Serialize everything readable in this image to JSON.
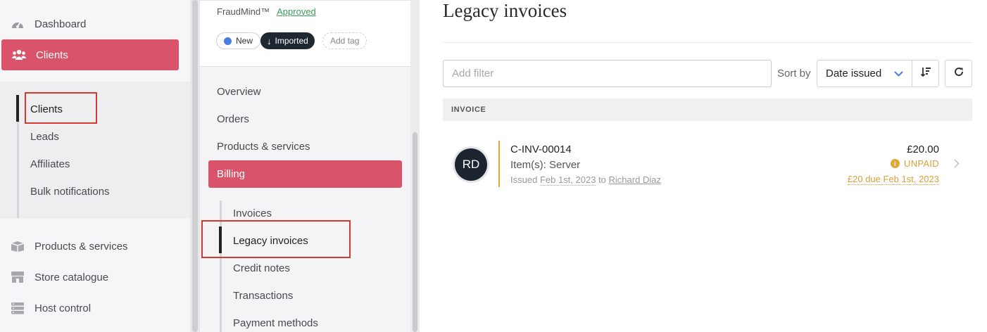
{
  "sidebar": {
    "items": [
      {
        "label": "Dashboard",
        "icon": "gauge-icon"
      },
      {
        "label": "Clients",
        "icon": "users-icon",
        "active": true
      },
      {
        "label": "Products & services",
        "icon": "box-icon"
      },
      {
        "label": "Store catalogue",
        "icon": "store-icon"
      },
      {
        "label": "Host control",
        "icon": "server-icon"
      }
    ],
    "subitems": [
      {
        "label": "Clients",
        "current": true
      },
      {
        "label": "Leads"
      },
      {
        "label": "Affiliates"
      },
      {
        "label": "Bulk notifications"
      }
    ]
  },
  "client_panel": {
    "fraud_label": "FraudMind™",
    "fraud_status": "Approved",
    "tags": {
      "new": "New",
      "imported": "Imported",
      "add": "Add tag"
    },
    "menu": [
      "Overview",
      "Orders",
      "Products & services",
      "Billing"
    ],
    "billing_sub": [
      "Invoices",
      "Legacy invoices",
      "Credit notes",
      "Transactions",
      "Payment methods"
    ]
  },
  "main": {
    "title": "Legacy invoices",
    "filter_placeholder": "Add filter",
    "sort_by_label": "Sort by",
    "sort_value": "Date issued",
    "table_header": "INVOICE",
    "invoice": {
      "initials": "RD",
      "number": "C-INV-00014",
      "items": "Item(s): Server",
      "issued_prefix": "Issued",
      "issued_date": "Feb 1st, 2023",
      "to_word": "to",
      "client": "Richard Diaz",
      "amount": "£20.00",
      "status": "UNPAID",
      "due": "£20 due Feb 1st, 2023"
    }
  },
  "colors": {
    "accent": "#d9536a",
    "dark": "#1f2733",
    "warning": "#e0a838",
    "success": "#3a9c5c",
    "link_blue": "#4a7de0"
  }
}
